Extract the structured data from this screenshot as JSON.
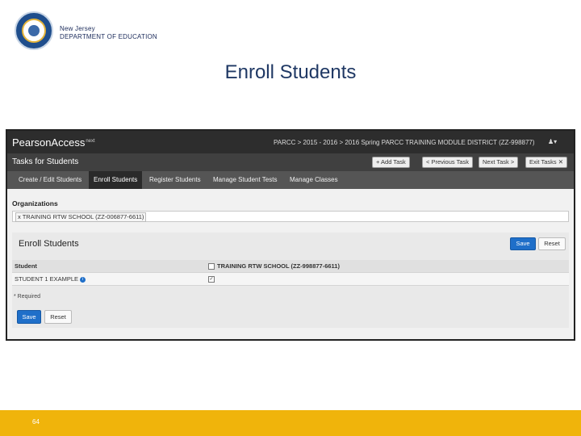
{
  "header": {
    "agency_line1": "New Jersey",
    "agency_line2": "DEPARTMENT OF EDUCATION",
    "slide_title": "Enroll Students"
  },
  "app": {
    "brand": "PearsonAccess",
    "brand_sup": "next",
    "breadcrumbs": "PARCC > 2015 - 2016 > 2016 Spring PARCC     TRAINING MODULE DISTRICT (ZZ-998877)",
    "user_icon": "user-icon",
    "section_title": "Tasks for Students",
    "task_buttons": {
      "add_task": "+ Add Task",
      "previous_task": "< Previous Task",
      "next_task": "Next Task >",
      "exit_tasks": "Exit Tasks ✕"
    },
    "tabs": [
      "Create / Edit Students",
      "Enroll Students",
      "Register Students",
      "Manage Student Tests",
      "Manage Classes"
    ],
    "active_tab": "Enroll Students",
    "organizations_label": "Organizations",
    "organization_tag": "x TRAINING RTW SCHOOL (ZZ-006877-6611)",
    "panel_title": "Enroll Students",
    "save_label": "Save",
    "reset_label": "Reset",
    "table": {
      "col_student": "Student",
      "col_school": "TRAINING RTW SCHOOL (ZZ-998877-6611)",
      "rows": [
        {
          "student": "STUDENT 1 EXAMPLE",
          "checked": true
        }
      ]
    },
    "required_note": "* Required",
    "bottom_save": "Save",
    "bottom_reset": "Reset"
  },
  "footer": {
    "page_number": "64"
  },
  "colors": {
    "title": "#1f3864",
    "footer": "#f0b40b",
    "primary_button": "#1f6fc9",
    "topbar": "#2d2d2d"
  }
}
